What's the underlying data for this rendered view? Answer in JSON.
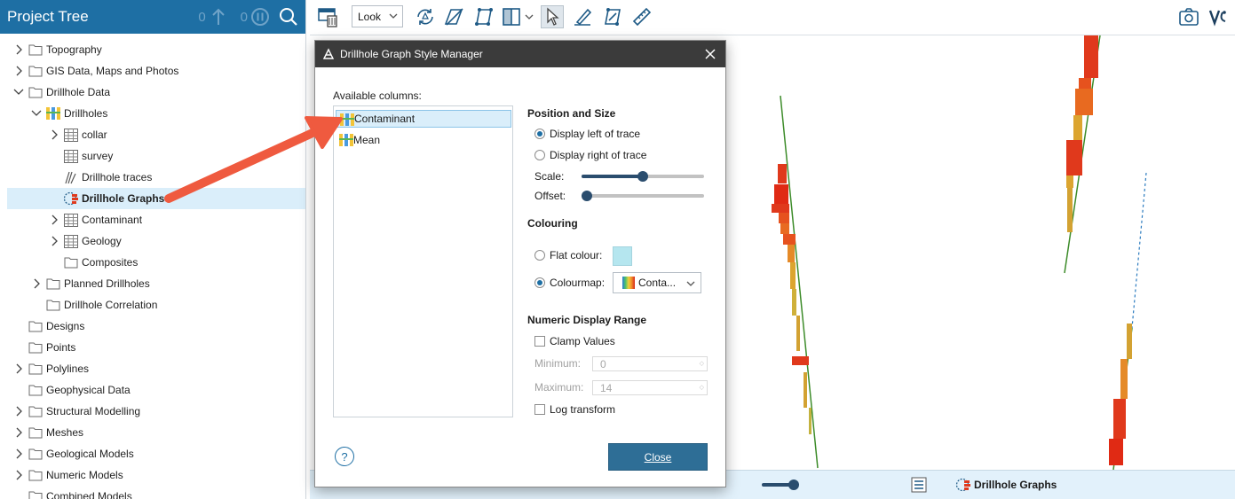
{
  "tree": {
    "title": "Project Tree",
    "count_left": "0",
    "count_right": "0",
    "items": [
      {
        "label": "Topography",
        "indent": 0,
        "expand": "collapsed",
        "icon": "folder-icon"
      },
      {
        "label": "GIS Data, Maps and Photos",
        "indent": 0,
        "expand": "collapsed",
        "icon": "folder-icon"
      },
      {
        "label": "Drillhole Data",
        "indent": 0,
        "expand": "expanded",
        "icon": "folder-icon"
      },
      {
        "label": "Drillholes",
        "indent": 1,
        "expand": "expanded",
        "icon": "drillholes-icon"
      },
      {
        "label": "collar",
        "indent": 2,
        "expand": "collapsed",
        "icon": "table-icon"
      },
      {
        "label": "survey",
        "indent": 2,
        "expand": "none",
        "icon": "table-icon"
      },
      {
        "label": "Drillhole traces",
        "indent": 2,
        "expand": "none",
        "icon": "traces-icon"
      },
      {
        "label": "Drillhole Graphs",
        "indent": 2,
        "expand": "none",
        "icon": "graph-icon",
        "selected": true
      },
      {
        "label": "Contaminant",
        "indent": 2,
        "expand": "collapsed",
        "icon": "table-icon"
      },
      {
        "label": "Geology",
        "indent": 2,
        "expand": "collapsed",
        "icon": "table-icon"
      },
      {
        "label": "Composites",
        "indent": 2,
        "expand": "none",
        "icon": "folder-icon"
      },
      {
        "label": "Planned Drillholes",
        "indent": 1,
        "expand": "collapsed",
        "icon": "folder-icon"
      },
      {
        "label": "Drillhole Correlation",
        "indent": 1,
        "expand": "none",
        "icon": "folder-icon"
      },
      {
        "label": "Designs",
        "indent": 0,
        "expand": "none",
        "icon": "folder-icon"
      },
      {
        "label": "Points",
        "indent": 0,
        "expand": "none",
        "icon": "folder-icon"
      },
      {
        "label": "Polylines",
        "indent": 0,
        "expand": "collapsed",
        "icon": "folder-icon"
      },
      {
        "label": "Geophysical Data",
        "indent": 0,
        "expand": "none",
        "icon": "folder-icon"
      },
      {
        "label": "Structural Modelling",
        "indent": 0,
        "expand": "collapsed",
        "icon": "folder-icon"
      },
      {
        "label": "Meshes",
        "indent": 0,
        "expand": "collapsed",
        "icon": "folder-icon"
      },
      {
        "label": "Geological Models",
        "indent": 0,
        "expand": "collapsed",
        "icon": "folder-icon"
      },
      {
        "label": "Numeric Models",
        "indent": 0,
        "expand": "collapsed",
        "icon": "folder-icon"
      },
      {
        "label": "Combined Models",
        "indent": 0,
        "expand": "none",
        "icon": "folder-icon"
      }
    ]
  },
  "toolbar": {
    "look_label": "Look"
  },
  "status": {
    "label": "Drillhole Graphs"
  },
  "dialog": {
    "title": "Drillhole Graph Style Manager",
    "available_label": "Available columns:",
    "columns": [
      {
        "label": "Contaminant",
        "selected": true
      },
      {
        "label": "Mean",
        "selected": false
      }
    ],
    "position_title": "Position and Size",
    "display_left": "Display left of trace",
    "display_right": "Display right of trace",
    "scale_label": "Scale:",
    "scale_value": 0.5,
    "offset_label": "Offset:",
    "offset_value": 0.0,
    "colouring_title": "Colouring",
    "flat_colour_label": "Flat colour:",
    "flat_colour": "#b5e6ef",
    "colourmap_label": "Colourmap:",
    "colourmap_value": "Conta...",
    "range_title": "Numeric Display Range",
    "clamp_label": "Clamp Values",
    "minimum_label": "Minimum:",
    "minimum_value": "0",
    "maximum_label": "Maximum:",
    "maximum_value": "14",
    "log_label": "Log transform",
    "close_label": "Close",
    "help_glyph": "?"
  },
  "colors": {
    "header": "#1e6fa4",
    "selection": "#daeefa",
    "close_button": "#2e6e96",
    "annotation_arrow": "#ef5a3f"
  }
}
